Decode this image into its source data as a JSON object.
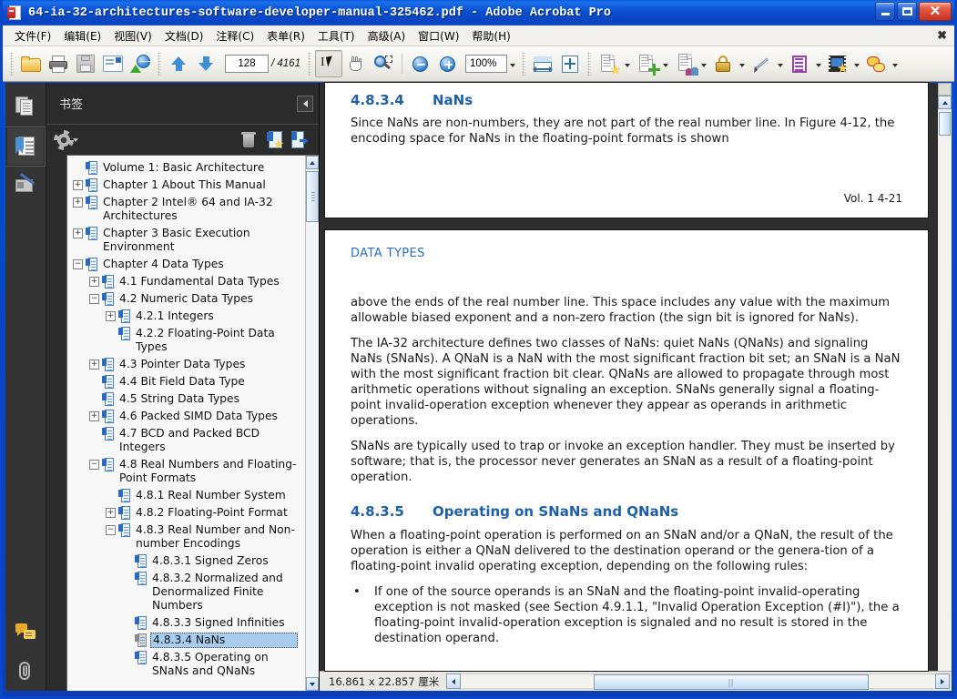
{
  "window": {
    "title": "64-ia-32-architectures-software-developer-manual-325462.pdf - Adobe Acrobat Pro",
    "minimize_label": "_",
    "maximize_label": "□",
    "close_label": "✕"
  },
  "menubar": {
    "items": [
      {
        "label": "文件(F)",
        "name": "menu-file"
      },
      {
        "label": "编辑(E)",
        "name": "menu-edit"
      },
      {
        "label": "视图(V)",
        "name": "menu-view"
      },
      {
        "label": "文档(D)",
        "name": "menu-document"
      },
      {
        "label": "注释(C)",
        "name": "menu-comment"
      },
      {
        "label": "表单(R)",
        "name": "menu-form"
      },
      {
        "label": "工具(T)",
        "name": "menu-tools"
      },
      {
        "label": "高级(A)",
        "name": "menu-advanced"
      },
      {
        "label": "窗口(W)",
        "name": "menu-window"
      },
      {
        "label": "帮助(H)",
        "name": "menu-help"
      }
    ],
    "close_doc_label": "✖"
  },
  "toolbar": {
    "open_icon": "folder-open-icon",
    "print_icon": "printer-icon",
    "save_icon": "save-icon",
    "email_icon": "email-icon",
    "webcapture_icon": "web-capture-icon",
    "prev_page_icon": "arrow-up-icon",
    "next_page_icon": "arrow-down-icon",
    "page_number": "128",
    "page_total": "/ 4161",
    "select_tool_icon": "select-text-icon",
    "hand_tool_icon": "hand-icon",
    "marquee_zoom_icon": "marquee-zoom-icon",
    "zoom_out_icon": "zoom-out-icon",
    "zoom_in_icon": "zoom-in-icon",
    "zoom_level": "100%",
    "fit_width_icon": "fit-width-icon",
    "fit_page_icon": "fit-page-icon",
    "create_pdf_icon": "create-pdf-icon",
    "combine_icon": "combine-files-icon",
    "collaborate_icon": "collaborate-icon",
    "secure_icon": "lock-icon",
    "sign_icon": "pen-sign-icon",
    "forms_icon": "forms-icon",
    "multimedia_icon": "multimedia-icon",
    "comment_icon": "comment-balloon-icon"
  },
  "rail": {
    "pages_icon": "pages-panel-icon",
    "bookmarks_icon": "bookmarks-panel-icon",
    "signatures_icon": "signatures-panel-icon",
    "comments_icon": "comments-panel-icon",
    "attachments_icon": "attachments-panel-icon"
  },
  "bookmarks_panel": {
    "title": "书签",
    "collapse_icon": "collapse-left-icon",
    "options_icon": "gear-options-icon",
    "delete_icon": "trash-icon",
    "new_bookmark_icon": "new-bookmark-icon",
    "goto_bookmark_icon": "goto-bookmark-icon",
    "items": [
      {
        "label": "Volume 1: Basic Architecture",
        "indent": 0,
        "toggle": "none"
      },
      {
        "label": "Chapter 1 About This Manual",
        "indent": 0,
        "toggle": "plus"
      },
      {
        "label": "Chapter 2 Intel® 64 and IA-32 Architectures",
        "indent": 0,
        "toggle": "plus"
      },
      {
        "label": "Chapter 3 Basic Execution Environment",
        "indent": 0,
        "toggle": "plus"
      },
      {
        "label": "Chapter 4 Data Types",
        "indent": 0,
        "toggle": "minus"
      },
      {
        "label": "4.1 Fundamental Data Types",
        "indent": 1,
        "toggle": "plus"
      },
      {
        "label": "4.2 Numeric Data Types",
        "indent": 1,
        "toggle": "minus"
      },
      {
        "label": "4.2.1 Integers",
        "indent": 2,
        "toggle": "plus"
      },
      {
        "label": "4.2.2 Floating-Point Data Types",
        "indent": 2,
        "toggle": "none"
      },
      {
        "label": "4.3 Pointer Data Types",
        "indent": 1,
        "toggle": "plus"
      },
      {
        "label": "4.4 Bit Field Data Type",
        "indent": 1,
        "toggle": "none"
      },
      {
        "label": "4.5 String Data Types",
        "indent": 1,
        "toggle": "none"
      },
      {
        "label": "4.6 Packed SIMD Data Types",
        "indent": 1,
        "toggle": "plus"
      },
      {
        "label": "4.7 BCD and Packed BCD Integers",
        "indent": 1,
        "toggle": "none"
      },
      {
        "label": "4.8 Real Numbers and Floating-Point Formats",
        "indent": 1,
        "toggle": "minus"
      },
      {
        "label": "4.8.1 Real Number System",
        "indent": 2,
        "toggle": "none"
      },
      {
        "label": "4.8.2 Floating-Point Format",
        "indent": 2,
        "toggle": "plus"
      },
      {
        "label": "4.8.3 Real Number and Non-number Encodings",
        "indent": 2,
        "toggle": "minus"
      },
      {
        "label": "4.8.3.1 Signed Zeros",
        "indent": 3,
        "toggle": "none"
      },
      {
        "label": "4.8.3.2 Normalized and Denormalized Finite Numbers",
        "indent": 3,
        "toggle": "none"
      },
      {
        "label": "4.8.3.3 Signed Infinities",
        "indent": 3,
        "toggle": "none"
      },
      {
        "label": "4.8.3.4 NaNs",
        "indent": 3,
        "toggle": "none",
        "selected": true
      },
      {
        "label": "4.8.3.5 Operating on SNaNs and QNaNs",
        "indent": 3,
        "toggle": "none"
      }
    ]
  },
  "document": {
    "page_top": {
      "heading_number": "4.8.3.4",
      "heading_title": "NaNs",
      "paragraph": "Since NaNs are non-numbers, they are not part of the real number line. In Figure 4-12, the encoding space for NaNs in the floating-point formats is shown",
      "footer": "Vol. 1  4-21"
    },
    "page_bottom": {
      "running_head": "DATA TYPES",
      "paragraphs": [
        "above the ends of the real number line. This space includes any value with the maximum allowable biased exponent and a non-zero fraction (the sign bit is ignored for NaNs).",
        "The IA-32 architecture defines two classes of NaNs: quiet NaNs (QNaNs) and signaling NaNs (SNaNs). A QNaN is a NaN with the most significant fraction bit set; an SNaN is a NaN with the most significant fraction bit clear. QNaNs are allowed to propagate through most arithmetic operations without signaling an exception. SNaNs generally signal a floating-point invalid-operation exception whenever they appear as operands in arithmetic operations.",
        "SNaNs are typically used to trap or invoke an exception handler. They must be inserted by software; that is, the processor never generates an SNaN as a result of a floating-point operation."
      ],
      "heading_number": "4.8.3.5",
      "heading_title": "Operating on SNaNs and QNaNs",
      "after_heading_paragraph": "When a floating-point operation is performed on an SNaN and/or a QNaN, the result of the operation is either a QNaN delivered to the destination operand or the genera-tion of a floating-point invalid operating exception, depending on the following rules:",
      "bullet_marker": "•",
      "bullet_text": "If one of the source operands is an SNaN and the floating-point invalid-operating exception is not masked (see Section 4.9.1.1, \"Invalid Operation Exception (#I)\"), the a floating-point invalid-operation exception is signaled and no result is stored in the destination operand."
    }
  },
  "statusbar": {
    "page_size": "16.861 x 22.857 厘米",
    "scroll_left_icon": "scroll-left-icon",
    "scroll_right_icon": "scroll-right-icon"
  }
}
